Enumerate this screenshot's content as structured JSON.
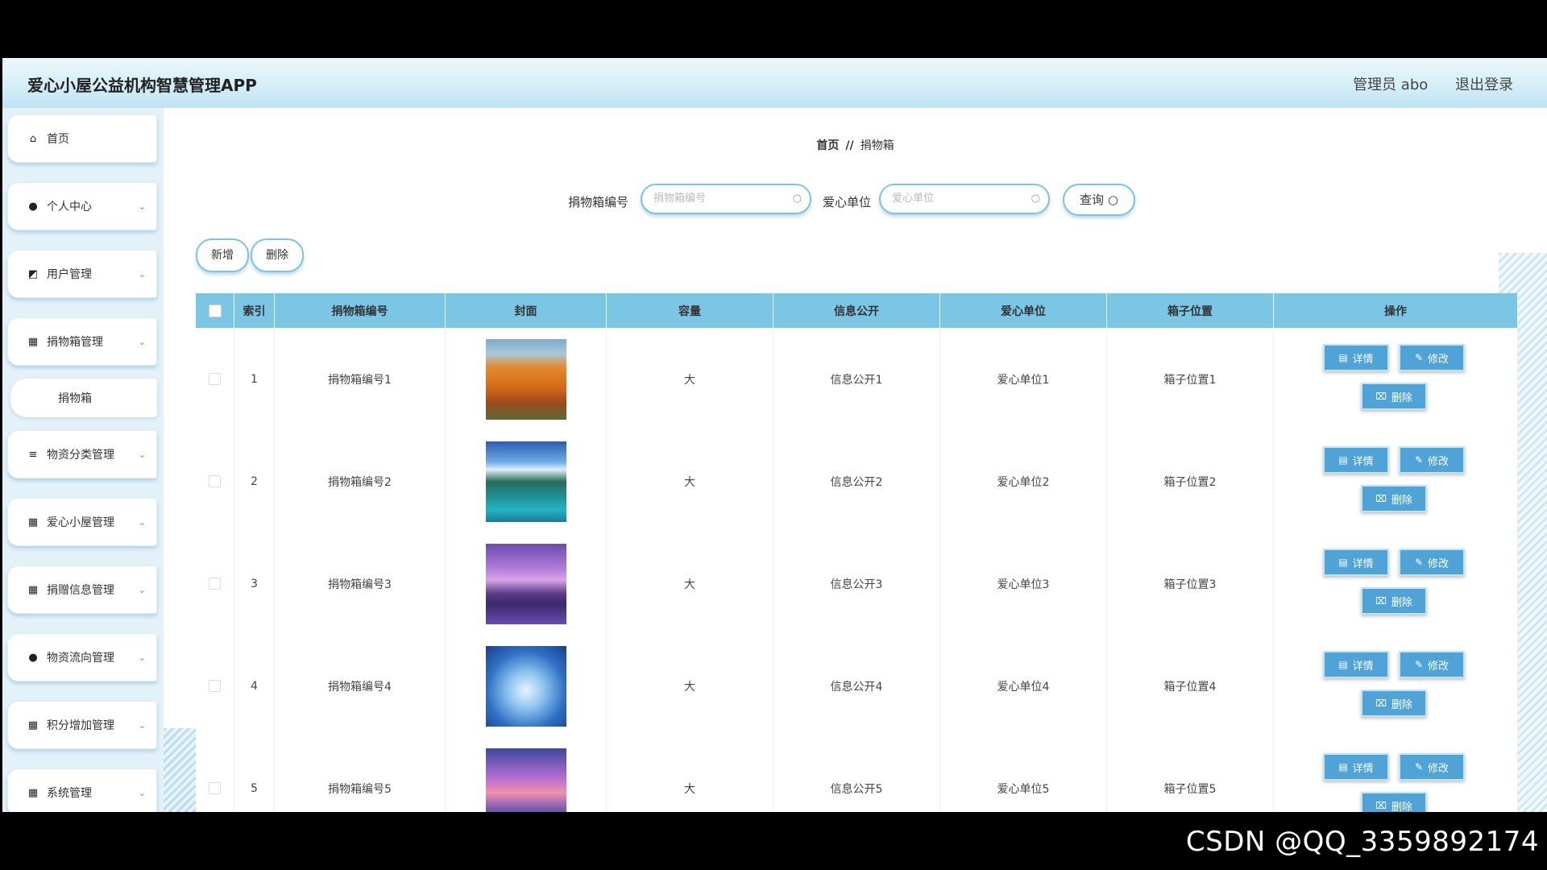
{
  "header": {
    "app_title": "爱心小屋公益机构智慧管理APP",
    "user_label": "管理员 abo",
    "logout_label": "退出登录"
  },
  "sidebar": {
    "items": [
      {
        "label": "首页",
        "icon": "home-icon",
        "glyph": "⌂",
        "arrow": false
      },
      {
        "label": "个人中心",
        "icon": "user-icon",
        "glyph": "●",
        "arrow": true
      },
      {
        "label": "用户管理",
        "icon": "user-manage-icon",
        "glyph": "◩",
        "arrow": true
      },
      {
        "label": "捐物箱管理",
        "icon": "grid-icon",
        "glyph": "▦",
        "arrow": true
      },
      {
        "label": "物资分类管理",
        "icon": "list-icon",
        "glyph": "≡",
        "arrow": true
      },
      {
        "label": "爱心小屋管理",
        "icon": "grid-icon",
        "glyph": "▦",
        "arrow": true
      },
      {
        "label": "捐赠信息管理",
        "icon": "apps-icon",
        "glyph": "▦",
        "arrow": true
      },
      {
        "label": "物资流向管理",
        "icon": "location-icon",
        "glyph": "●",
        "arrow": true
      },
      {
        "label": "积分增加管理",
        "icon": "grid-icon",
        "glyph": "▦",
        "arrow": true
      },
      {
        "label": "系统管理",
        "icon": "grid-icon",
        "glyph": "▦",
        "arrow": true
      }
    ],
    "sub_item": "捐物箱",
    "arrow_glyph": "⌄"
  },
  "breadcrumb": {
    "home": "首页",
    "sep": "//",
    "current": "捐物箱"
  },
  "search": {
    "box_no_label": "捐物箱编号",
    "box_no_placeholder": "捐物箱编号",
    "unit_label": "爱心单位",
    "unit_placeholder": "爱心单位",
    "query_label": "查询",
    "search_glyph": "○"
  },
  "actions": {
    "add_label": "新增",
    "delete_label": "删除"
  },
  "table": {
    "columns": [
      "",
      "索引",
      "捐物箱编号",
      "封面",
      "容量",
      "信息公开",
      "爱心单位",
      "箱子位置",
      "操作"
    ],
    "rows": [
      {
        "index": "1",
        "box_no": "捐物箱编号1",
        "capacity": "大",
        "info": "信息公开1",
        "unit": "爱心单位1",
        "location": "箱子位置1",
        "cover": "autumn-bridge"
      },
      {
        "index": "2",
        "box_no": "捐物箱编号2",
        "capacity": "大",
        "info": "信息公开2",
        "unit": "爱心单位2",
        "location": "箱子位置2",
        "cover": "lagoon"
      },
      {
        "index": "3",
        "box_no": "捐物箱编号3",
        "capacity": "大",
        "info": "信息公开3",
        "unit": "爱心单位3",
        "location": "箱子位置3",
        "cover": "purple-sea"
      },
      {
        "index": "4",
        "box_no": "捐物箱编号4",
        "capacity": "大",
        "info": "信息公开4",
        "unit": "爱心单位4",
        "location": "箱子位置4",
        "cover": "blue-sky"
      },
      {
        "index": "5",
        "box_no": "捐物箱编号5",
        "capacity": "大",
        "info": "信息公开5",
        "unit": "爱心单位5",
        "location": "箱子位置5",
        "cover": "pink-clouds"
      }
    ],
    "op_detail": "详情",
    "op_edit": "修改",
    "op_delete": "删除"
  },
  "watermark": "CSDN @QQ_3359892174",
  "colors": {
    "accent": "#7cc6e5",
    "button": "#4fa3d6"
  }
}
